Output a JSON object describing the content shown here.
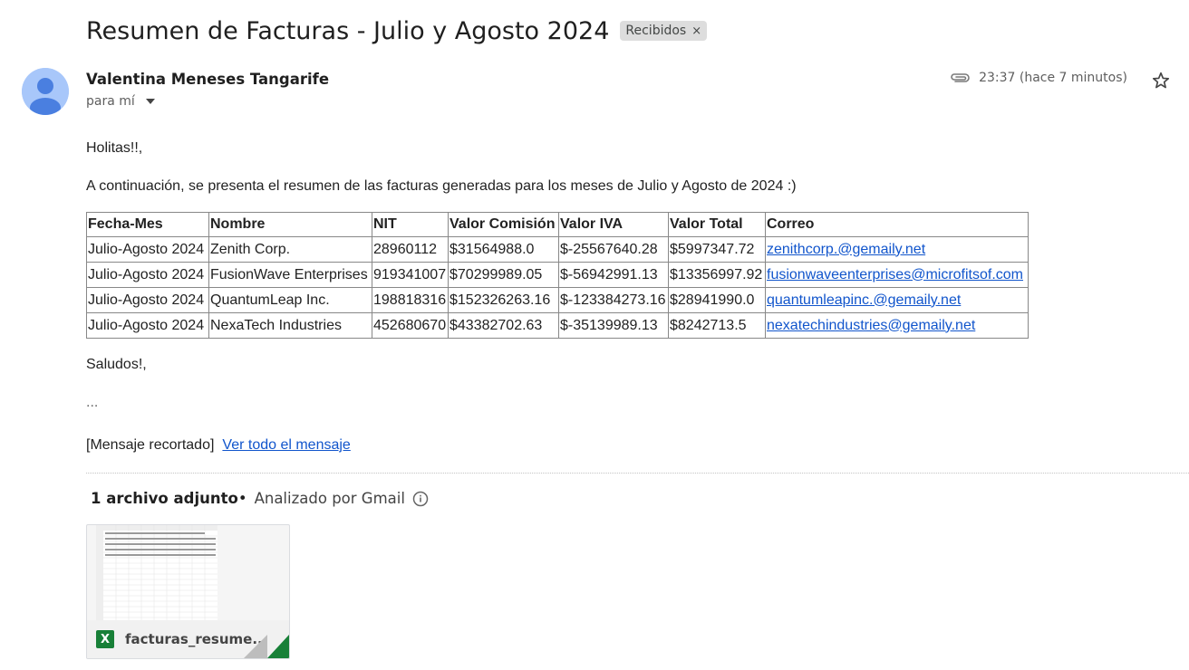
{
  "email": {
    "subject": "Resumen de Facturas - Julio y Agosto 2024",
    "label": "Recibidos",
    "label_remove": "×",
    "sender": "Valentina Meneses Tangarife",
    "to": "para mí",
    "time": "23:37 (hace 7 minutos)"
  },
  "body": {
    "greeting": "Holitas!!,",
    "intro": "A continuación, se presenta el resumen de las facturas generadas para los meses de Julio y Agosto de 2024 :)",
    "closing": "Saludos!,",
    "ellipsis": "...",
    "trimmed": "[Mensaje recortado]",
    "view_all": "Ver todo el mensaje"
  },
  "table": {
    "headers": [
      "Fecha-Mes",
      "Nombre",
      "NIT",
      "Valor Comisión",
      "Valor IVA",
      "Valor Total",
      "Correo"
    ],
    "rows": [
      [
        "Julio-Agosto 2024",
        "Zenith Corp.",
        "28960112",
        "$31564988.0",
        "$-25567640.28",
        "$5997347.72",
        "zenithcorp.@gemaily.net"
      ],
      [
        "Julio-Agosto 2024",
        "FusionWave Enterprises",
        "919341007",
        "$70299989.05",
        "$-56942991.13",
        "$13356997.92",
        "fusionwaveenterprises@microfitsof.com"
      ],
      [
        "Julio-Agosto 2024",
        "QuantumLeap Inc.",
        "198818316",
        "$152326263.16",
        "$-123384273.16",
        "$28941990.0",
        "quantumleapinc.@gemaily.net"
      ],
      [
        "Julio-Agosto 2024",
        "NexaTech Industries",
        "452680670",
        "$43382702.63",
        "$-35139989.13",
        "$8242713.5",
        "nexatechindustries@gemaily.net"
      ]
    ]
  },
  "attachments": {
    "count_label": "1 archivo adjunto",
    "separator": "•",
    "scanned": "Analizado por Gmail",
    "file_name": "facturas_resume...",
    "file_icon_letter": "X"
  },
  "colors": {
    "link": "#1155cc",
    "excel_green": "#188038",
    "avatar": "#a8c7fa"
  }
}
